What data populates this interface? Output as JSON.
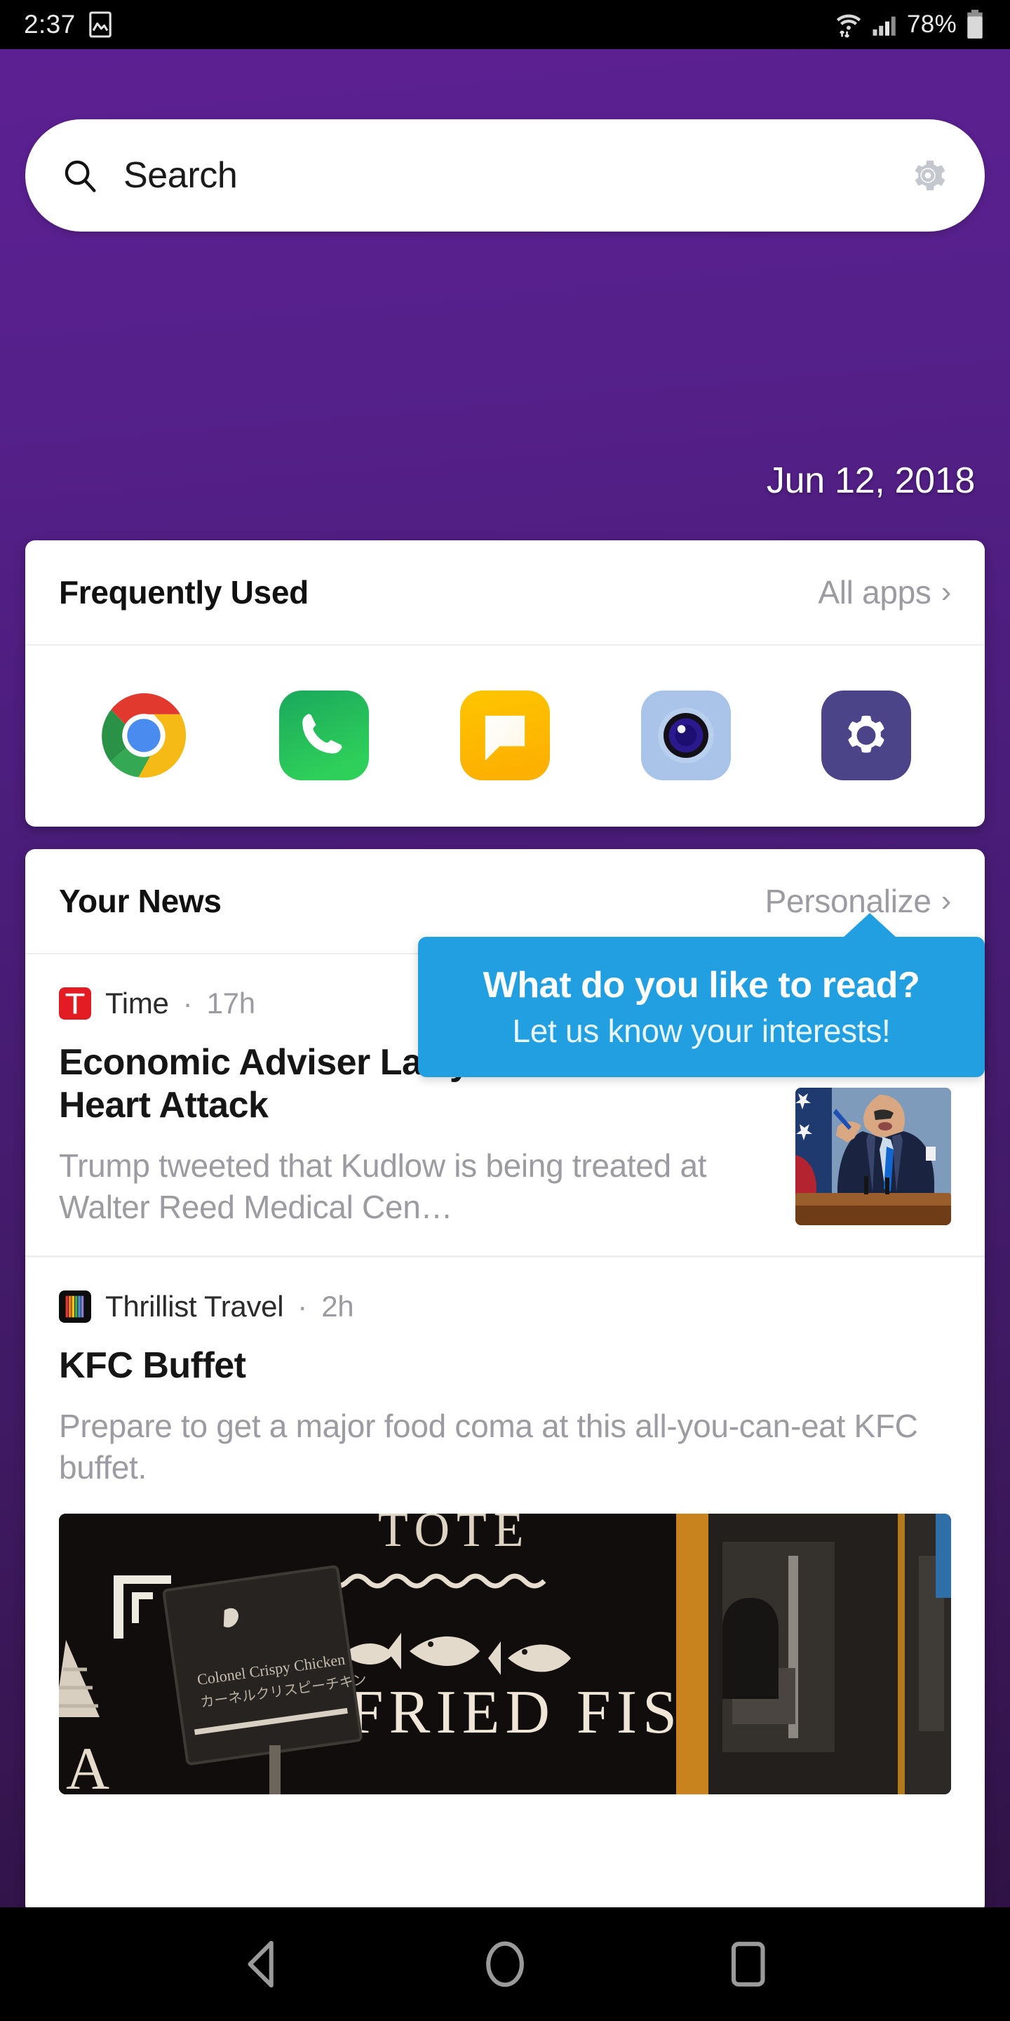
{
  "status_bar": {
    "time": "2:37",
    "screenshot_icon": "image-icon",
    "wifi_icon": "wifi-data-icon",
    "signal_icon": "cell-signal-icon",
    "battery_percent": "78%",
    "battery_icon": "battery-icon"
  },
  "search": {
    "placeholder": "Search",
    "search_icon": "search-icon",
    "settings_icon": "gear-icon"
  },
  "date": "Jun 12, 2018",
  "frequently_used": {
    "title": "Frequently Used",
    "action_label": "All apps",
    "action_chevron": "›",
    "apps": [
      {
        "name": "Chrome",
        "icon": "chrome-icon"
      },
      {
        "name": "Phone",
        "icon": "phone-icon"
      },
      {
        "name": "Messages",
        "icon": "messages-icon"
      },
      {
        "name": "Camera",
        "icon": "camera-icon"
      },
      {
        "name": "Settings",
        "icon": "settings-gear-icon"
      }
    ]
  },
  "your_news": {
    "title": "Your News",
    "action_label": "Personalize",
    "action_chevron": "›",
    "articles": [
      {
        "source": "Time",
        "source_icon": "time-logo-icon",
        "separator": "·",
        "age": "17h",
        "headline": "Economic Adviser Larry Kudlow Suffers a Heart Attack",
        "summary": "Trump tweeted that Kudlow is being treated at Walter Reed Medical Cen…",
        "thumbnail": "man-at-podium-photo"
      },
      {
        "source": "Thrillist Travel",
        "source_icon": "thrillist-logo-icon",
        "separator": "·",
        "age": "2h",
        "headline": "KFC Buffet",
        "summary": "Prepare to get a major food coma at this all-you-can-eat KFC buffet.",
        "hero_image": "deep-fried-fish-storefront-photo",
        "hero_text": "DEEP FRIED FISH"
      }
    ]
  },
  "tooltip": {
    "title": "What do you like to read?",
    "subtitle": "Let us know your interests!"
  },
  "nav_bar": {
    "back": "back-triangle-icon",
    "home": "home-circle-icon",
    "recents": "recents-square-icon"
  },
  "colors": {
    "background_purple_top": "#5d2092",
    "background_purple_bottom": "#2e1243",
    "tooltip_blue": "#229fe0",
    "muted_gray": "#9b9ba1"
  }
}
